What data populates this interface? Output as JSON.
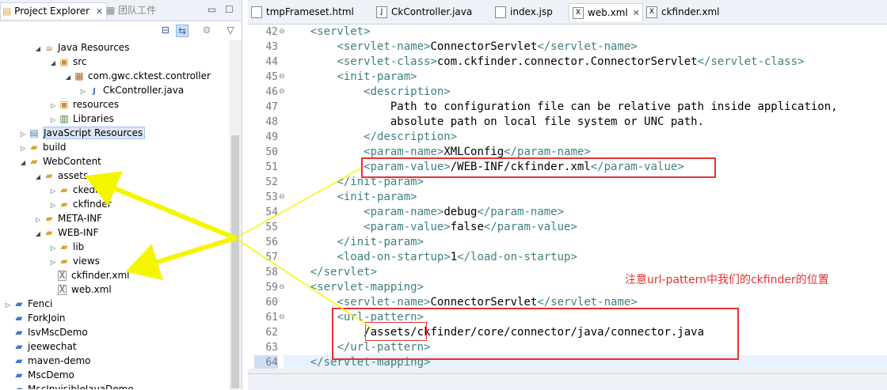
{
  "left_panel": {
    "tab_project_explorer": "Project Explorer",
    "tab_team": "团队工件",
    "tree": [
      {
        "label": "Java Resources",
        "icon": "java-resources-icon",
        "twisty": "open",
        "depth": 2
      },
      {
        "label": "src",
        "icon": "source-folder-icon",
        "twisty": "open",
        "depth": 3
      },
      {
        "label": "com.gwc.cktest.controller",
        "icon": "package-icon",
        "twisty": "open",
        "depth": 4
      },
      {
        "label": "CkController.java",
        "icon": "java-file-icon",
        "twisty": "closed",
        "depth": 5
      },
      {
        "label": "resources",
        "icon": "source-folder-icon",
        "twisty": "closed",
        "depth": 3
      },
      {
        "label": "Libraries",
        "icon": "library-icon",
        "twisty": "closed",
        "depth": 3
      },
      {
        "label": "JavaScript Resources",
        "icon": "javascript-resources-icon",
        "twisty": "closed",
        "depth": 1,
        "selected": true
      },
      {
        "label": "build",
        "icon": "folder-icon",
        "twisty": "closed",
        "depth": 1
      },
      {
        "label": "WebContent",
        "icon": "folder-icon",
        "twisty": "open",
        "depth": 1
      },
      {
        "label": "assets",
        "icon": "folder-icon",
        "twisty": "open",
        "depth": 2
      },
      {
        "label": "ckeditor",
        "icon": "folder-icon",
        "twisty": "closed",
        "depth": 3
      },
      {
        "label": "ckfinder",
        "icon": "folder-icon",
        "twisty": "closed",
        "depth": 3
      },
      {
        "label": "META-INF",
        "icon": "folder-icon",
        "twisty": "closed",
        "depth": 2
      },
      {
        "label": "WEB-INF",
        "icon": "folder-icon",
        "twisty": "open",
        "depth": 2
      },
      {
        "label": "lib",
        "icon": "folder-icon",
        "twisty": "closed",
        "depth": 3
      },
      {
        "label": "views",
        "icon": "folder-icon",
        "twisty": "closed",
        "depth": 3
      },
      {
        "label": "ckfinder.xml",
        "icon": "xml-file-icon",
        "twisty": "none",
        "depth": 3
      },
      {
        "label": "web.xml",
        "icon": "xml-file-icon",
        "twisty": "none",
        "depth": 3
      },
      {
        "label": "Fenci",
        "icon": "project-icon",
        "twisty": "closed",
        "depth": 0
      },
      {
        "label": "ForkJoin",
        "icon": "project-icon",
        "twisty": "none",
        "depth": 0
      },
      {
        "label": "IsvMscDemo",
        "icon": "project-icon",
        "twisty": "none",
        "depth": 0
      },
      {
        "label": "jeewechat",
        "icon": "project-icon",
        "twisty": "none",
        "depth": 0
      },
      {
        "label": "maven-demo",
        "icon": "project-icon",
        "twisty": "none",
        "depth": 0
      },
      {
        "label": "MscDemo",
        "icon": "project-icon",
        "twisty": "none",
        "depth": 0
      },
      {
        "label": "MscInvisibleJavaDemo",
        "icon": "project-icon",
        "twisty": "none",
        "depth": 0
      }
    ]
  },
  "editor": {
    "tabs": [
      {
        "label": "tmpFrameset.html",
        "icon": "html-file-icon",
        "active": false
      },
      {
        "label": "CkController.java",
        "icon": "java-file-icon",
        "active": false
      },
      {
        "label": "index.jsp",
        "icon": "jsp-file-icon",
        "active": false
      },
      {
        "label": "web.xml",
        "icon": "xml-file-icon",
        "active": true
      },
      {
        "label": "ckfinder.xml",
        "icon": "xml-file-icon",
        "active": false
      }
    ],
    "lines": [
      {
        "num": "42",
        "fold": true,
        "segs": [
          [
            "    ",
            ""
          ],
          [
            "<servlet>",
            "t"
          ]
        ]
      },
      {
        "num": "43",
        "fold": false,
        "segs": [
          [
            "        ",
            ""
          ],
          [
            "<servlet-name>",
            "t"
          ],
          [
            "ConnectorServlet",
            "v"
          ],
          [
            "</servlet-name>",
            "t"
          ]
        ]
      },
      {
        "num": "44",
        "fold": false,
        "segs": [
          [
            "        ",
            ""
          ],
          [
            "<servlet-class>",
            "t"
          ],
          [
            "com.ckfinder.connector.ConnectorServlet",
            "v"
          ],
          [
            "</servlet-class>",
            "t"
          ]
        ]
      },
      {
        "num": "45",
        "fold": true,
        "segs": [
          [
            "        ",
            ""
          ],
          [
            "<init-param>",
            "t"
          ]
        ]
      },
      {
        "num": "46",
        "fold": true,
        "segs": [
          [
            "            ",
            ""
          ],
          [
            "<description>",
            "t"
          ]
        ]
      },
      {
        "num": "47",
        "fold": false,
        "segs": [
          [
            "                ",
            ""
          ],
          [
            "Path to configuration file can be relative path inside application,",
            "v"
          ]
        ]
      },
      {
        "num": "48",
        "fold": false,
        "segs": [
          [
            "                ",
            ""
          ],
          [
            "absolute path on local file system or UNC path.",
            "v"
          ]
        ]
      },
      {
        "num": "49",
        "fold": false,
        "segs": [
          [
            "            ",
            ""
          ],
          [
            "</description>",
            "t"
          ]
        ]
      },
      {
        "num": "50",
        "fold": false,
        "segs": [
          [
            "            ",
            ""
          ],
          [
            "<param-name>",
            "t"
          ],
          [
            "XMLConfig",
            "v"
          ],
          [
            "</param-name>",
            "t"
          ]
        ]
      },
      {
        "num": "51",
        "fold": false,
        "segs": [
          [
            "            ",
            ""
          ],
          [
            "<param-value>",
            "t"
          ],
          [
            "/WEB-INF/ckfinder.xml",
            "v"
          ],
          [
            "</param-value>",
            "t"
          ]
        ]
      },
      {
        "num": "52",
        "fold": false,
        "segs": [
          [
            "        ",
            ""
          ],
          [
            "</init-param>",
            "t"
          ]
        ]
      },
      {
        "num": "53",
        "fold": true,
        "segs": [
          [
            "        ",
            ""
          ],
          [
            "<init-param>",
            "t"
          ]
        ]
      },
      {
        "num": "54",
        "fold": false,
        "segs": [
          [
            "            ",
            ""
          ],
          [
            "<param-name>",
            "t"
          ],
          [
            "debug",
            "v"
          ],
          [
            "</param-name>",
            "t"
          ]
        ]
      },
      {
        "num": "55",
        "fold": false,
        "segs": [
          [
            "            ",
            ""
          ],
          [
            "<param-value>",
            "t"
          ],
          [
            "false",
            "v"
          ],
          [
            "</param-value>",
            "t"
          ]
        ]
      },
      {
        "num": "56",
        "fold": false,
        "segs": [
          [
            "        ",
            ""
          ],
          [
            "</init-param>",
            "t"
          ]
        ]
      },
      {
        "num": "57",
        "fold": false,
        "segs": [
          [
            "        ",
            ""
          ],
          [
            "<load-on-startup>",
            "t"
          ],
          [
            "1",
            "v"
          ],
          [
            "</load-on-startup>",
            "t"
          ]
        ]
      },
      {
        "num": "58",
        "fold": false,
        "segs": [
          [
            "    ",
            ""
          ],
          [
            "</servlet>",
            "t"
          ]
        ]
      },
      {
        "num": "59",
        "fold": true,
        "segs": [
          [
            "    ",
            ""
          ],
          [
            "<servlet-mapping>",
            "t"
          ]
        ]
      },
      {
        "num": "60",
        "fold": false,
        "segs": [
          [
            "        ",
            ""
          ],
          [
            "<servlet-name>",
            "t"
          ],
          [
            "ConnectorServlet",
            "v"
          ],
          [
            "</servlet-name>",
            "t"
          ]
        ]
      },
      {
        "num": "61",
        "fold": true,
        "segs": [
          [
            "        ",
            ""
          ],
          [
            "<url-pattern>",
            "t"
          ]
        ]
      },
      {
        "num": "62",
        "fold": false,
        "segs": [
          [
            "            ",
            ""
          ],
          [
            "/assets/ckfinder/core/connector/java/connector.java",
            "v"
          ]
        ]
      },
      {
        "num": "63",
        "fold": false,
        "segs": [
          [
            "        ",
            ""
          ],
          [
            "</url-pattern>",
            "t"
          ]
        ]
      },
      {
        "num": "64",
        "fold": false,
        "segs": [
          [
            "    ",
            ""
          ],
          [
            "</servlet-mapping>",
            "t"
          ]
        ]
      }
    ],
    "current_line": "64"
  },
  "annotation": {
    "note": "注意url-pattern中我们的ckfinder的位置",
    "color": "#e83030",
    "arrow_color": "#f5f500"
  }
}
